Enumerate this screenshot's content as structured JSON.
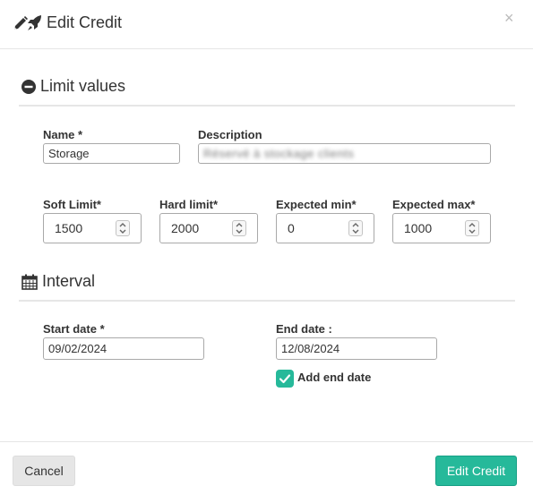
{
  "modal": {
    "title": "Edit Credit",
    "close_symbol": "×"
  },
  "icons": {
    "header": [
      "pencil-icon",
      "rocket-icon"
    ],
    "limit_section": "minus-circle-icon",
    "interval_section": "calendar-icon",
    "spinner": "up-down-spinner-icon",
    "checkbox": "checkmark-icon"
  },
  "limit_section": {
    "title": "Limit values",
    "name": {
      "label": "Name *",
      "value": "Storage"
    },
    "description": {
      "label": "Description",
      "value": "Réservé à stockage clients"
    },
    "soft_limit": {
      "label": "Soft Limit*",
      "value": "1500"
    },
    "hard_limit": {
      "label": "Hard limit*",
      "value": "2000"
    },
    "expected_min": {
      "label": "Expected min*",
      "value": "0"
    },
    "expected_max": {
      "label": "Expected max*",
      "value": "1000"
    }
  },
  "interval_section": {
    "title": "Interval",
    "start_date": {
      "label": "Start date *",
      "value": "09/02/2024"
    },
    "end_date": {
      "label": "End date :",
      "value": "12/08/2024"
    },
    "add_end_date": {
      "label": "Add end date",
      "checked": true
    }
  },
  "footer": {
    "cancel_label": "Cancel",
    "submit_label": "Edit Credit"
  },
  "colors": {
    "accent": "#26b99a",
    "accent_border": "#169f85",
    "cancel_bg": "#e6e6e6"
  }
}
